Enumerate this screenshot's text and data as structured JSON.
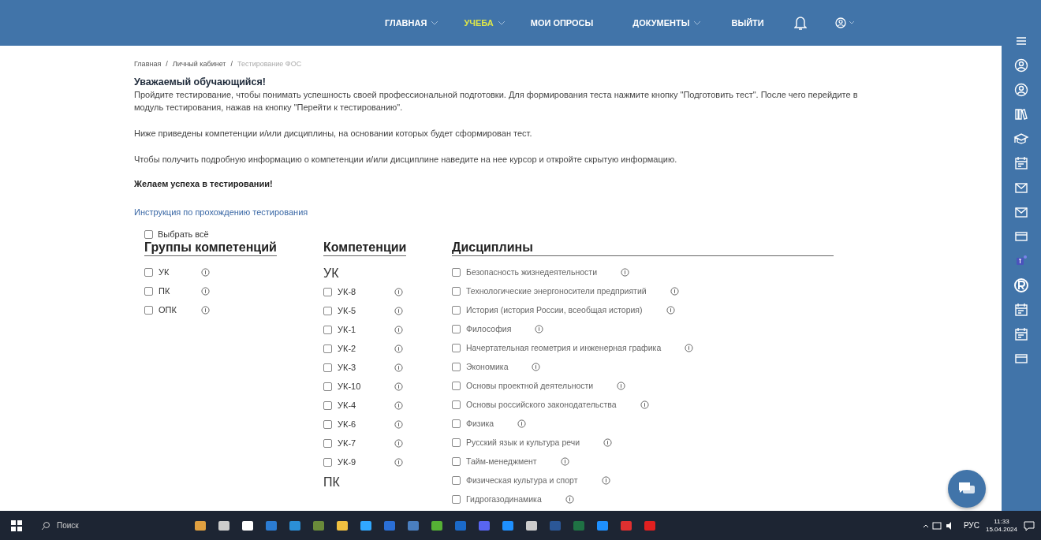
{
  "nav": [
    {
      "label": "ГЛАВНАЯ",
      "selected": false,
      "dropdown": true
    },
    {
      "label": "УЧЕБА",
      "selected": true,
      "dropdown": true
    },
    {
      "label": "МОИ ОПРОСЫ",
      "selected": false,
      "dropdown": false
    },
    {
      "label": "ДОКУМЕНТЫ",
      "selected": false,
      "dropdown": true
    },
    {
      "label": "ВЫЙТИ",
      "selected": false,
      "dropdown": false
    }
  ],
  "breadcrumbs": [
    {
      "label": "Главная",
      "current": false
    },
    {
      "label": "Личный кабинет",
      "current": false,
      "separator": "/"
    },
    {
      "label": "Тестирование ФОС",
      "current": true,
      "separator": "/"
    }
  ],
  "intro": {
    "title": "Уважаемый обучающийся!",
    "paragraphs": [
      "Пройдите тестирование, чтобы понимать успешность своей профессиональной подготовки. Для формирования теста нажмите кнопку \"Подготовить тест\". После чего перейдите в модуль тестирования, нажав на кнопку \"Перейти к тестированию\".",
      "Ниже приведены компетенции и/или дисциплины, на основании которых будет сформирован тест.",
      "Чтобы получить подробную информацию о компетенции и/или дисциплине наведите на нее курсор и откройте скрытую информацию."
    ],
    "wish": "Желаем успеха в тестировании!",
    "link": "Инструкция по прохождению тестирования"
  },
  "select_all": {
    "label": "Выбрать всё",
    "checked": false
  },
  "groups": {
    "title": "Группы компетенций",
    "items": [
      {
        "label": "УК",
        "checked": false
      },
      {
        "label": "ПК",
        "checked": false
      },
      {
        "label": "ОПК",
        "checked": false
      }
    ]
  },
  "competencies": {
    "title": "Компетенции",
    "sections": [
      {
        "title": "УК",
        "items": [
          {
            "label": "УК-8",
            "checked": false
          },
          {
            "label": "УК-5",
            "checked": false
          },
          {
            "label": "УК-1",
            "checked": false
          },
          {
            "label": "УК-2",
            "checked": false
          },
          {
            "label": "УК-3",
            "checked": false
          },
          {
            "label": "УК-10",
            "checked": false
          },
          {
            "label": "УК-4",
            "checked": false
          },
          {
            "label": "УК-6",
            "checked": false
          },
          {
            "label": "УК-7",
            "checked": false
          },
          {
            "label": "УК-9",
            "checked": false
          }
        ]
      },
      {
        "title": "ПК"
      }
    ]
  },
  "disciplines": {
    "title": "Дисциплины",
    "items": [
      {
        "label": "Безопасность жизнедеятельности",
        "checked": false
      },
      {
        "label": "Технологические энергоносители предприятий",
        "checked": false
      },
      {
        "label": "История (история России, всеобщая история)",
        "checked": false
      },
      {
        "label": "Философия",
        "checked": false
      },
      {
        "label": "Начертательная геометрия и инженерная графика",
        "checked": false
      },
      {
        "label": "Экономика",
        "checked": false
      },
      {
        "label": "Основы проектной деятельности",
        "checked": false
      },
      {
        "label": "Основы российского законодательства",
        "checked": false
      },
      {
        "label": "Физика",
        "checked": false
      },
      {
        "label": "Русский язык и культура речи",
        "checked": false
      },
      {
        "label": "Тайм-менеджмент",
        "checked": false
      },
      {
        "label": "Физическая культура и спорт",
        "checked": false
      },
      {
        "label": "Гидрогазодинамика",
        "checked": false
      }
    ]
  },
  "taskbar": {
    "search_placeholder": "Поиск",
    "language": "РУС",
    "time": "11:33",
    "date": "15.04.2024"
  }
}
